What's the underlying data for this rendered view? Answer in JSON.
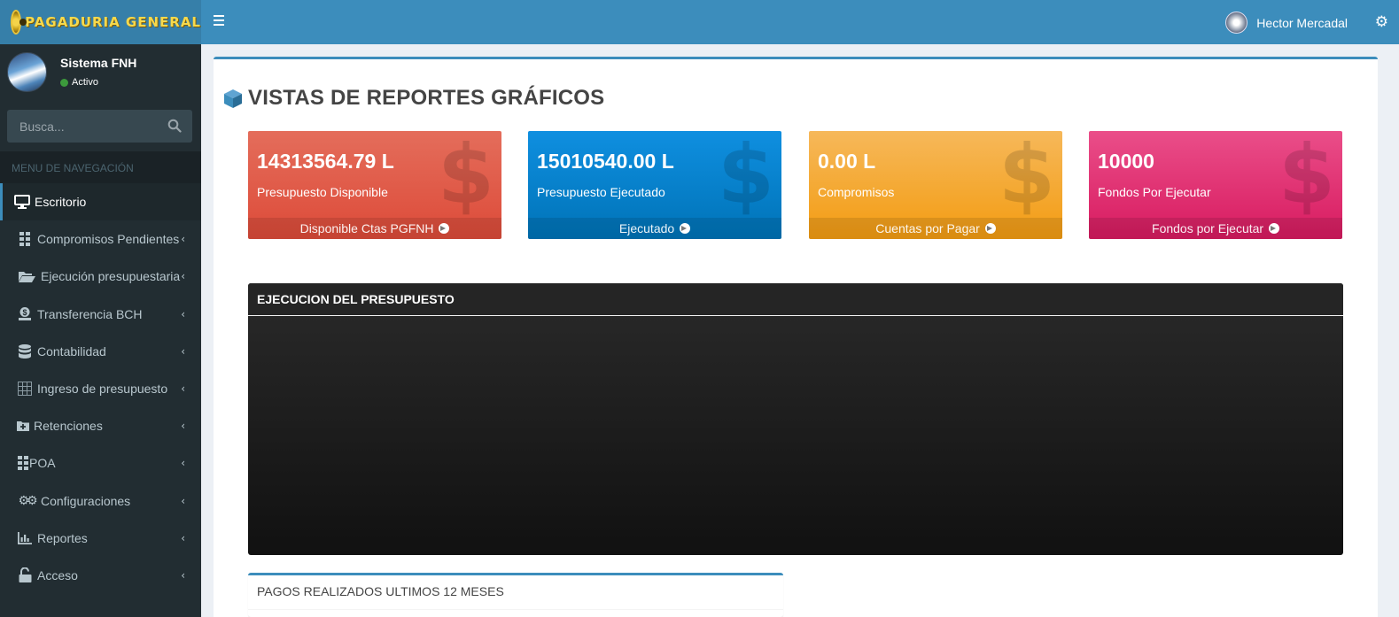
{
  "brand": {
    "logo_text": "PAGADURIA GENERAL"
  },
  "topbar": {
    "user_name": "Hector Mercadal"
  },
  "sidebar": {
    "user": {
      "name": "Sistema FNH",
      "status": "Activo"
    },
    "search": {
      "placeholder": "Busca..."
    },
    "menu_header": "MENU DE NAVEGACIÓN",
    "items": [
      {
        "label": "Escritorio",
        "icon": "desktop-icon",
        "active": true
      },
      {
        "label": "Compromisos Pendientes",
        "icon": "grid-icon"
      },
      {
        "label": "Ejecución presupuestaria",
        "icon": "folder-open-icon"
      },
      {
        "label": "Transferencia BCH",
        "icon": "money-transfer-icon"
      },
      {
        "label": "Contabilidad",
        "icon": "database-icon"
      },
      {
        "label": "Ingreso de presupuesto",
        "icon": "table-grid-icon"
      },
      {
        "label": "Retenciones",
        "icon": "folder-plus-icon"
      },
      {
        "label": "POA",
        "icon": "grid-icon"
      },
      {
        "label": "Configuraciones",
        "icon": "gears-icon"
      },
      {
        "label": "Reportes",
        "icon": "bar-chart-icon"
      },
      {
        "label": "Acceso",
        "icon": "unlock-icon"
      }
    ]
  },
  "page": {
    "title": "VISTAS DE REPORTES GRÁFICOS"
  },
  "cards": [
    {
      "value": "14313564.79 L",
      "label": "Presupuesto Disponible",
      "footer": "Disponible Ctas PGFNH",
      "color": "#dd4b39"
    },
    {
      "value": "15010540.00 L",
      "label": "Presupuesto Ejecutado",
      "footer": "Ejecutado",
      "color": "#0073b7"
    },
    {
      "value": "0.00 L",
      "label": "Compromisos",
      "footer": "Cuentas por Pagar",
      "color": "#f39c12"
    },
    {
      "value": "10000",
      "label": "Fondos Por Ejecutar",
      "footer": "Fondos por Ejecutar",
      "color": "#d81b60"
    }
  ],
  "chart_panel": {
    "title": "EJECUCION DEL PRESUPUESTO"
  },
  "pagos_panel": {
    "title": "PAGOS REALIZADOS ULTIMOS 12 MESES"
  },
  "colors": {
    "header": "#3c8dbc",
    "logo_bg": "#367fa9",
    "sidebar": "#222d32",
    "accent_gold": "#f7d94c"
  }
}
